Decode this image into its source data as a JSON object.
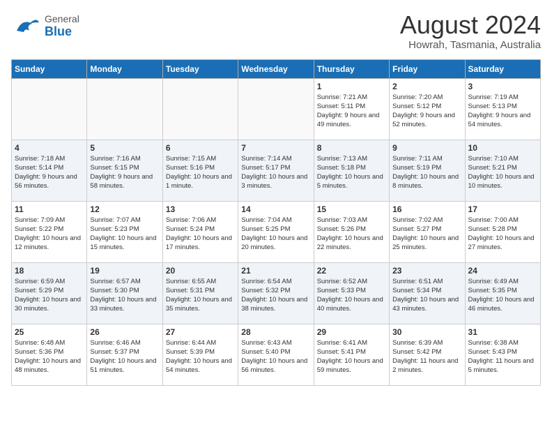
{
  "header": {
    "logo_general": "General",
    "logo_blue": "Blue",
    "month_year": "August 2024",
    "location": "Howrah, Tasmania, Australia"
  },
  "weekdays": [
    "Sunday",
    "Monday",
    "Tuesday",
    "Wednesday",
    "Thursday",
    "Friday",
    "Saturday"
  ],
  "weeks": [
    [
      {
        "day": "",
        "sunrise": "",
        "sunset": "",
        "daylight": ""
      },
      {
        "day": "",
        "sunrise": "",
        "sunset": "",
        "daylight": ""
      },
      {
        "day": "",
        "sunrise": "",
        "sunset": "",
        "daylight": ""
      },
      {
        "day": "",
        "sunrise": "",
        "sunset": "",
        "daylight": ""
      },
      {
        "day": "1",
        "sunrise": "Sunrise: 7:21 AM",
        "sunset": "Sunset: 5:11 PM",
        "daylight": "Daylight: 9 hours and 49 minutes."
      },
      {
        "day": "2",
        "sunrise": "Sunrise: 7:20 AM",
        "sunset": "Sunset: 5:12 PM",
        "daylight": "Daylight: 9 hours and 52 minutes."
      },
      {
        "day": "3",
        "sunrise": "Sunrise: 7:19 AM",
        "sunset": "Sunset: 5:13 PM",
        "daylight": "Daylight: 9 hours and 54 minutes."
      }
    ],
    [
      {
        "day": "4",
        "sunrise": "Sunrise: 7:18 AM",
        "sunset": "Sunset: 5:14 PM",
        "daylight": "Daylight: 9 hours and 56 minutes."
      },
      {
        "day": "5",
        "sunrise": "Sunrise: 7:16 AM",
        "sunset": "Sunset: 5:15 PM",
        "daylight": "Daylight: 9 hours and 58 minutes."
      },
      {
        "day": "6",
        "sunrise": "Sunrise: 7:15 AM",
        "sunset": "Sunset: 5:16 PM",
        "daylight": "Daylight: 10 hours and 1 minute."
      },
      {
        "day": "7",
        "sunrise": "Sunrise: 7:14 AM",
        "sunset": "Sunset: 5:17 PM",
        "daylight": "Daylight: 10 hours and 3 minutes."
      },
      {
        "day": "8",
        "sunrise": "Sunrise: 7:13 AM",
        "sunset": "Sunset: 5:18 PM",
        "daylight": "Daylight: 10 hours and 5 minutes."
      },
      {
        "day": "9",
        "sunrise": "Sunrise: 7:11 AM",
        "sunset": "Sunset: 5:19 PM",
        "daylight": "Daylight: 10 hours and 8 minutes."
      },
      {
        "day": "10",
        "sunrise": "Sunrise: 7:10 AM",
        "sunset": "Sunset: 5:21 PM",
        "daylight": "Daylight: 10 hours and 10 minutes."
      }
    ],
    [
      {
        "day": "11",
        "sunrise": "Sunrise: 7:09 AM",
        "sunset": "Sunset: 5:22 PM",
        "daylight": "Daylight: 10 hours and 12 minutes."
      },
      {
        "day": "12",
        "sunrise": "Sunrise: 7:07 AM",
        "sunset": "Sunset: 5:23 PM",
        "daylight": "Daylight: 10 hours and 15 minutes."
      },
      {
        "day": "13",
        "sunrise": "Sunrise: 7:06 AM",
        "sunset": "Sunset: 5:24 PM",
        "daylight": "Daylight: 10 hours and 17 minutes."
      },
      {
        "day": "14",
        "sunrise": "Sunrise: 7:04 AM",
        "sunset": "Sunset: 5:25 PM",
        "daylight": "Daylight: 10 hours and 20 minutes."
      },
      {
        "day": "15",
        "sunrise": "Sunrise: 7:03 AM",
        "sunset": "Sunset: 5:26 PM",
        "daylight": "Daylight: 10 hours and 22 minutes."
      },
      {
        "day": "16",
        "sunrise": "Sunrise: 7:02 AM",
        "sunset": "Sunset: 5:27 PM",
        "daylight": "Daylight: 10 hours and 25 minutes."
      },
      {
        "day": "17",
        "sunrise": "Sunrise: 7:00 AM",
        "sunset": "Sunset: 5:28 PM",
        "daylight": "Daylight: 10 hours and 27 minutes."
      }
    ],
    [
      {
        "day": "18",
        "sunrise": "Sunrise: 6:59 AM",
        "sunset": "Sunset: 5:29 PM",
        "daylight": "Daylight: 10 hours and 30 minutes."
      },
      {
        "day": "19",
        "sunrise": "Sunrise: 6:57 AM",
        "sunset": "Sunset: 5:30 PM",
        "daylight": "Daylight: 10 hours and 33 minutes."
      },
      {
        "day": "20",
        "sunrise": "Sunrise: 6:55 AM",
        "sunset": "Sunset: 5:31 PM",
        "daylight": "Daylight: 10 hours and 35 minutes."
      },
      {
        "day": "21",
        "sunrise": "Sunrise: 6:54 AM",
        "sunset": "Sunset: 5:32 PM",
        "daylight": "Daylight: 10 hours and 38 minutes."
      },
      {
        "day": "22",
        "sunrise": "Sunrise: 6:52 AM",
        "sunset": "Sunset: 5:33 PM",
        "daylight": "Daylight: 10 hours and 40 minutes."
      },
      {
        "day": "23",
        "sunrise": "Sunrise: 6:51 AM",
        "sunset": "Sunset: 5:34 PM",
        "daylight": "Daylight: 10 hours and 43 minutes."
      },
      {
        "day": "24",
        "sunrise": "Sunrise: 6:49 AM",
        "sunset": "Sunset: 5:35 PM",
        "daylight": "Daylight: 10 hours and 46 minutes."
      }
    ],
    [
      {
        "day": "25",
        "sunrise": "Sunrise: 6:48 AM",
        "sunset": "Sunset: 5:36 PM",
        "daylight": "Daylight: 10 hours and 48 minutes."
      },
      {
        "day": "26",
        "sunrise": "Sunrise: 6:46 AM",
        "sunset": "Sunset: 5:37 PM",
        "daylight": "Daylight: 10 hours and 51 minutes."
      },
      {
        "day": "27",
        "sunrise": "Sunrise: 6:44 AM",
        "sunset": "Sunset: 5:39 PM",
        "daylight": "Daylight: 10 hours and 54 minutes."
      },
      {
        "day": "28",
        "sunrise": "Sunrise: 6:43 AM",
        "sunset": "Sunset: 5:40 PM",
        "daylight": "Daylight: 10 hours and 56 minutes."
      },
      {
        "day": "29",
        "sunrise": "Sunrise: 6:41 AM",
        "sunset": "Sunset: 5:41 PM",
        "daylight": "Daylight: 10 hours and 59 minutes."
      },
      {
        "day": "30",
        "sunrise": "Sunrise: 6:39 AM",
        "sunset": "Sunset: 5:42 PM",
        "daylight": "Daylight: 11 hours and 2 minutes."
      },
      {
        "day": "31",
        "sunrise": "Sunrise: 6:38 AM",
        "sunset": "Sunset: 5:43 PM",
        "daylight": "Daylight: 11 hours and 5 minutes."
      }
    ]
  ]
}
